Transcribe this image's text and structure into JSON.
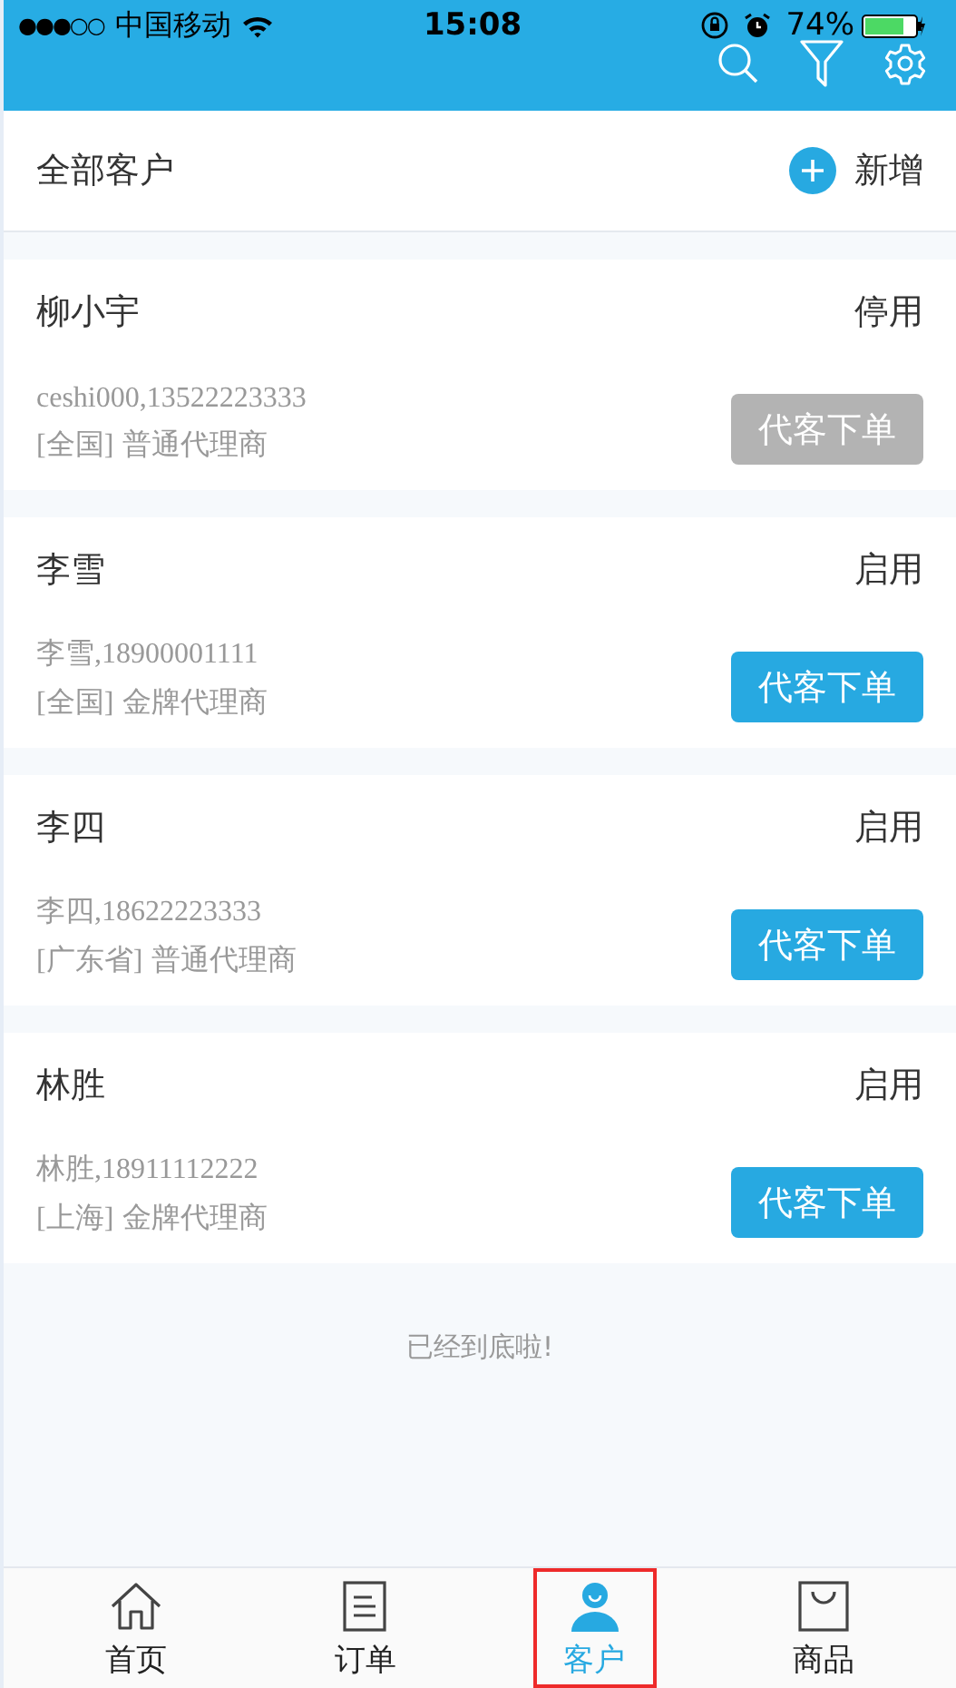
{
  "status_bar": {
    "signal": "●●●○○",
    "carrier": "中国移动",
    "time": "15:08",
    "battery": "74%"
  },
  "list_header": {
    "title": "全部客户",
    "add_label": "新增"
  },
  "customers": [
    {
      "name": "柳小宇",
      "status": "停用",
      "info": "ceshi000,13522223333",
      "region": "[全国]",
      "agent_type": "普通代理商",
      "button": "代客下单",
      "disabled": true
    },
    {
      "name": "李雪",
      "status": "启用",
      "info": "李雪,18900001111",
      "region": "[全国]",
      "agent_type": "金牌代理商",
      "button": "代客下单",
      "disabled": false
    },
    {
      "name": "李四",
      "status": "启用",
      "info": "李四,18622223333",
      "region": "[广东省]",
      "agent_type": "普通代理商",
      "button": "代客下单",
      "disabled": false
    },
    {
      "name": "林胜",
      "status": "启用",
      "info": "林胜,18911112222",
      "region": "[上海]",
      "agent_type": "金牌代理商",
      "button": "代客下单",
      "disabled": false
    }
  ],
  "end_note": "已经到底啦!",
  "tabs": [
    {
      "label": "首页",
      "kind": "home",
      "selected": false,
      "highlighted": false
    },
    {
      "label": "订单",
      "kind": "orders",
      "selected": false,
      "highlighted": false
    },
    {
      "label": "客户",
      "kind": "customers",
      "selected": true,
      "highlighted": true
    },
    {
      "label": "商品",
      "kind": "goods",
      "selected": false,
      "highlighted": false
    }
  ]
}
